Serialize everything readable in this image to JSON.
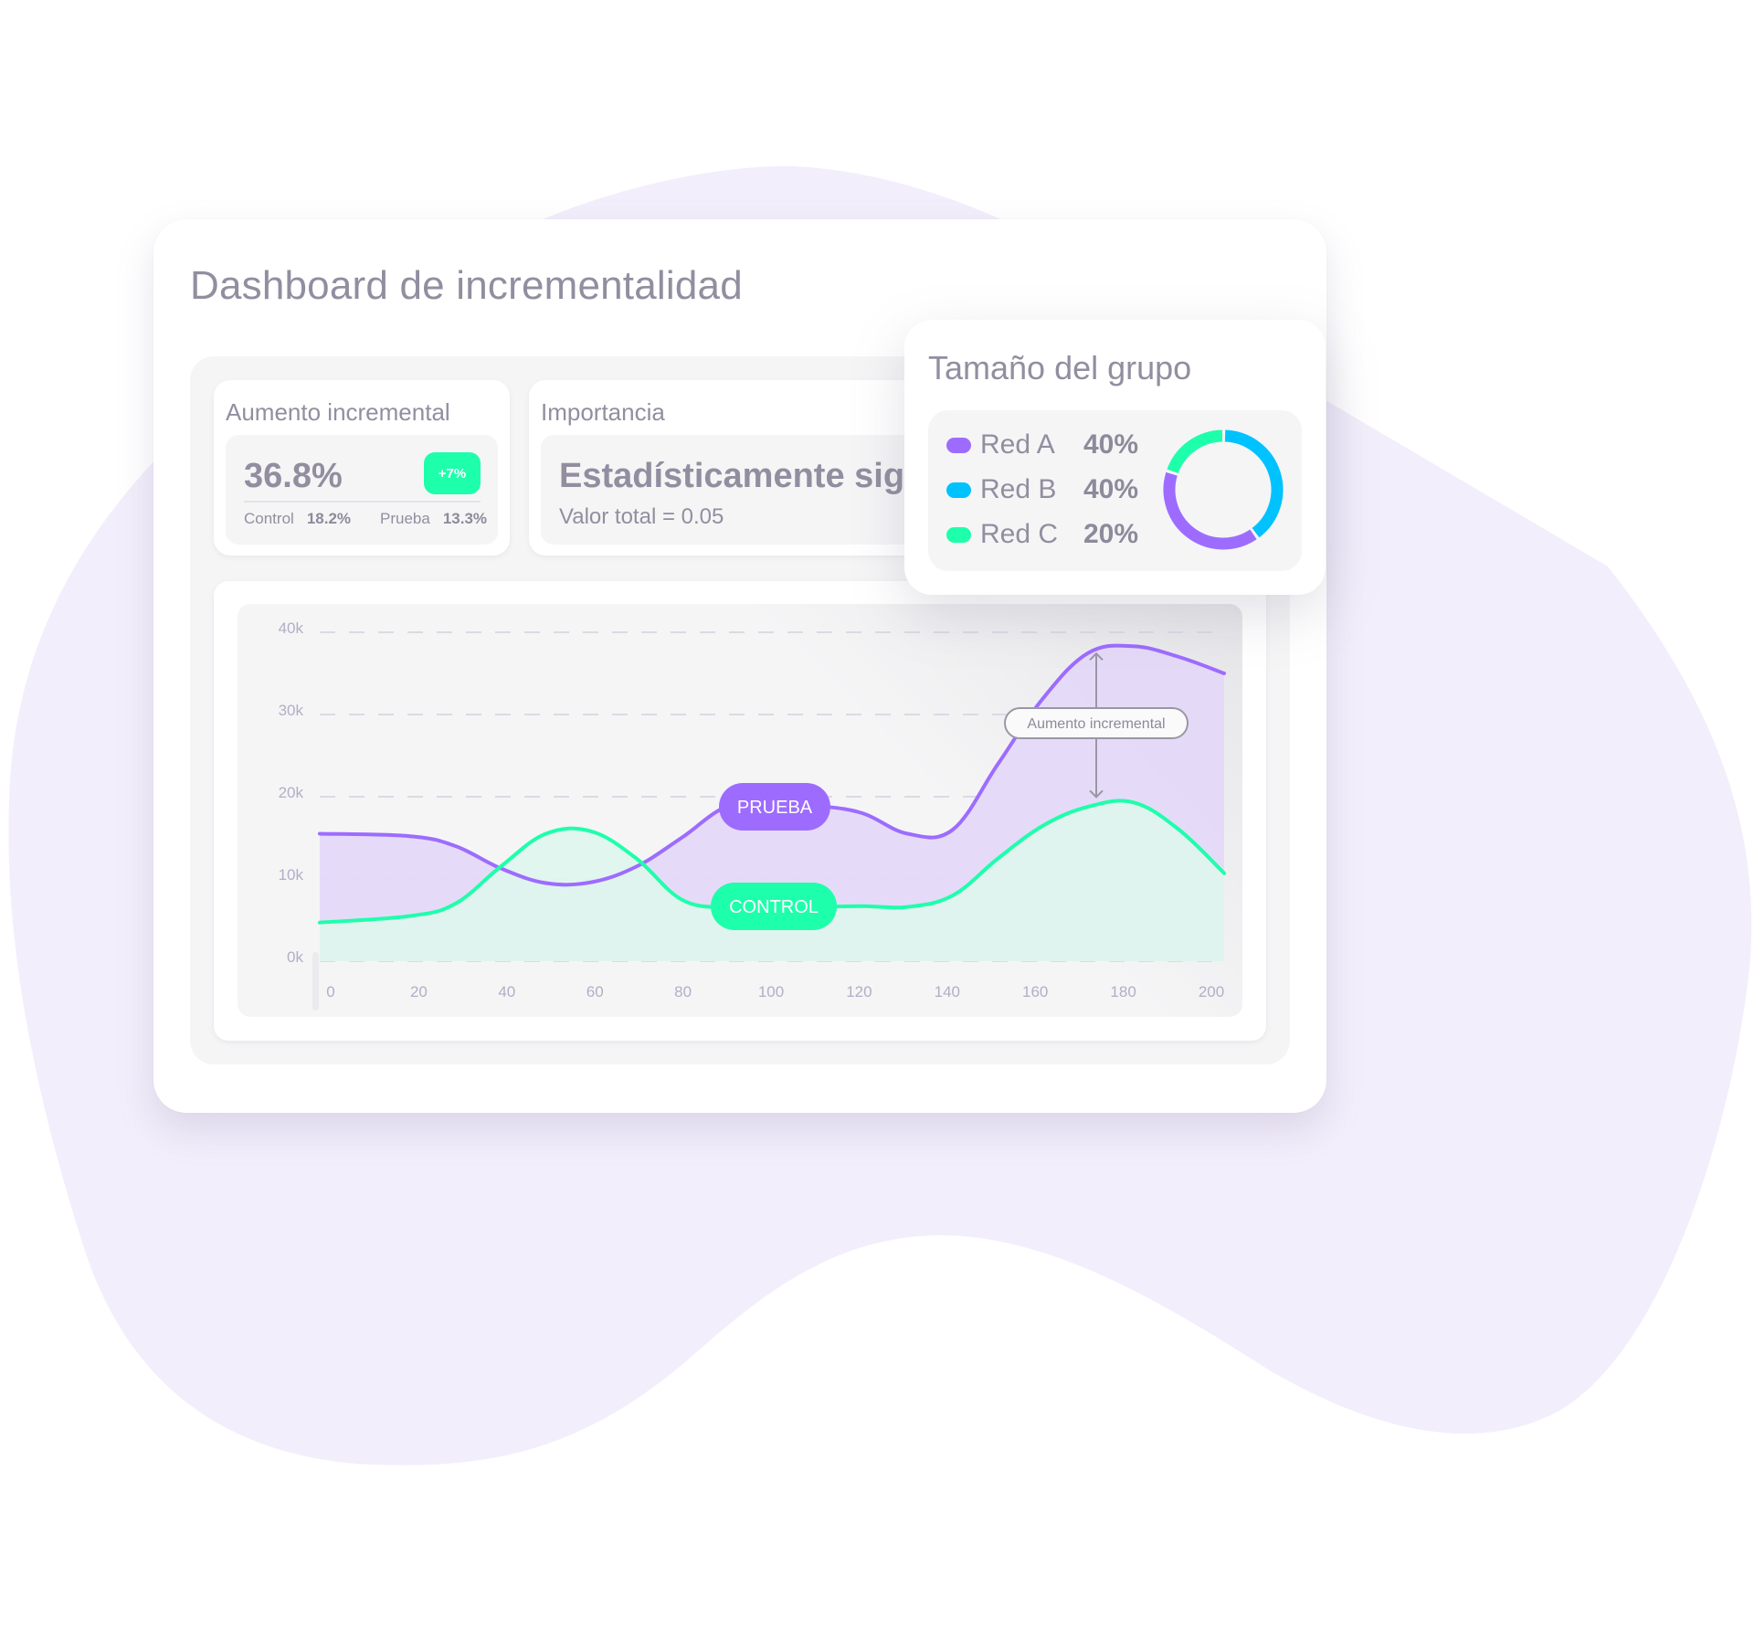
{
  "header": {
    "title": "Dashboard de incrementalidad"
  },
  "kpis": {
    "incremental_lift": {
      "label": "Aumento incremental",
      "value": "36.8%",
      "delta_badge": "+7%",
      "control_label": "Control",
      "control_value": "18.2%",
      "test_label": "Prueba",
      "test_value": "13.3%"
    },
    "significance": {
      "label": "Importancia",
      "value": "Estadísticamente significativo",
      "subtext": "Valor total = 0.05"
    }
  },
  "group_size": {
    "title": "Tamaño del grupo",
    "items": [
      {
        "name": "Red A",
        "percent": "40%",
        "value": 40,
        "color": "#9d6cff"
      },
      {
        "name": "Red B",
        "percent": "40%",
        "value": 40,
        "color": "#00c2ff"
      },
      {
        "name": "Red C",
        "percent": "20%",
        "value": 20,
        "color": "#1effab"
      }
    ]
  },
  "colors": {
    "prueba": "#9d6cff",
    "control": "#1effab",
    "prueba_fill": "#e4d9f8",
    "control_fill": "#dff6ee",
    "text": "#928ea0",
    "axis_text": "#b4adc6",
    "grid": "#dcd9e4",
    "badge_green": "#1effab"
  },
  "chart_data": [
    {
      "type": "area",
      "title": "",
      "xlabel": "",
      "ylabel": "",
      "x_ticks": [
        "0",
        "20",
        "40",
        "60",
        "80",
        "100",
        "120",
        "140",
        "160",
        "180",
        "200"
      ],
      "y_ticks": [
        "0k",
        "10k",
        "20k",
        "30k",
        "40k"
      ],
      "xlim": [
        0,
        200
      ],
      "ylim": [
        0,
        40000
      ],
      "grid": "horizontal-dashed",
      "x": [
        0,
        20,
        30,
        40,
        50,
        60,
        70,
        80,
        90,
        100,
        110,
        120,
        130,
        140,
        150,
        160,
        170,
        180,
        190,
        200
      ],
      "series": [
        {
          "name": "Prueba",
          "label": "PRUEBA",
          "values": [
            15500,
            15200,
            14000,
            11300,
            9500,
            9600,
            11500,
            15000,
            18800,
            19300,
            18900,
            18000,
            15500,
            16000,
            24000,
            32000,
            37500,
            38300,
            37000,
            35000
          ]
        },
        {
          "name": "Control",
          "label": "CONTROL",
          "values": [
            4700,
            5500,
            7000,
            11500,
            15500,
            15800,
            12500,
            7500,
            6500,
            6500,
            6600,
            6700,
            6600,
            8000,
            12500,
            16500,
            18800,
            19300,
            16000,
            10700
          ]
        }
      ],
      "annotations": [
        {
          "text": "Aumento incremental",
          "x": 178,
          "from_series": "Control",
          "to_series": "Prueba"
        }
      ]
    },
    {
      "type": "pie",
      "title": "Tamaño del grupo",
      "categories": [
        "Red A",
        "Red B",
        "Red C"
      ],
      "values": [
        40,
        40,
        20
      ],
      "donut": true,
      "legend": "left"
    }
  ]
}
